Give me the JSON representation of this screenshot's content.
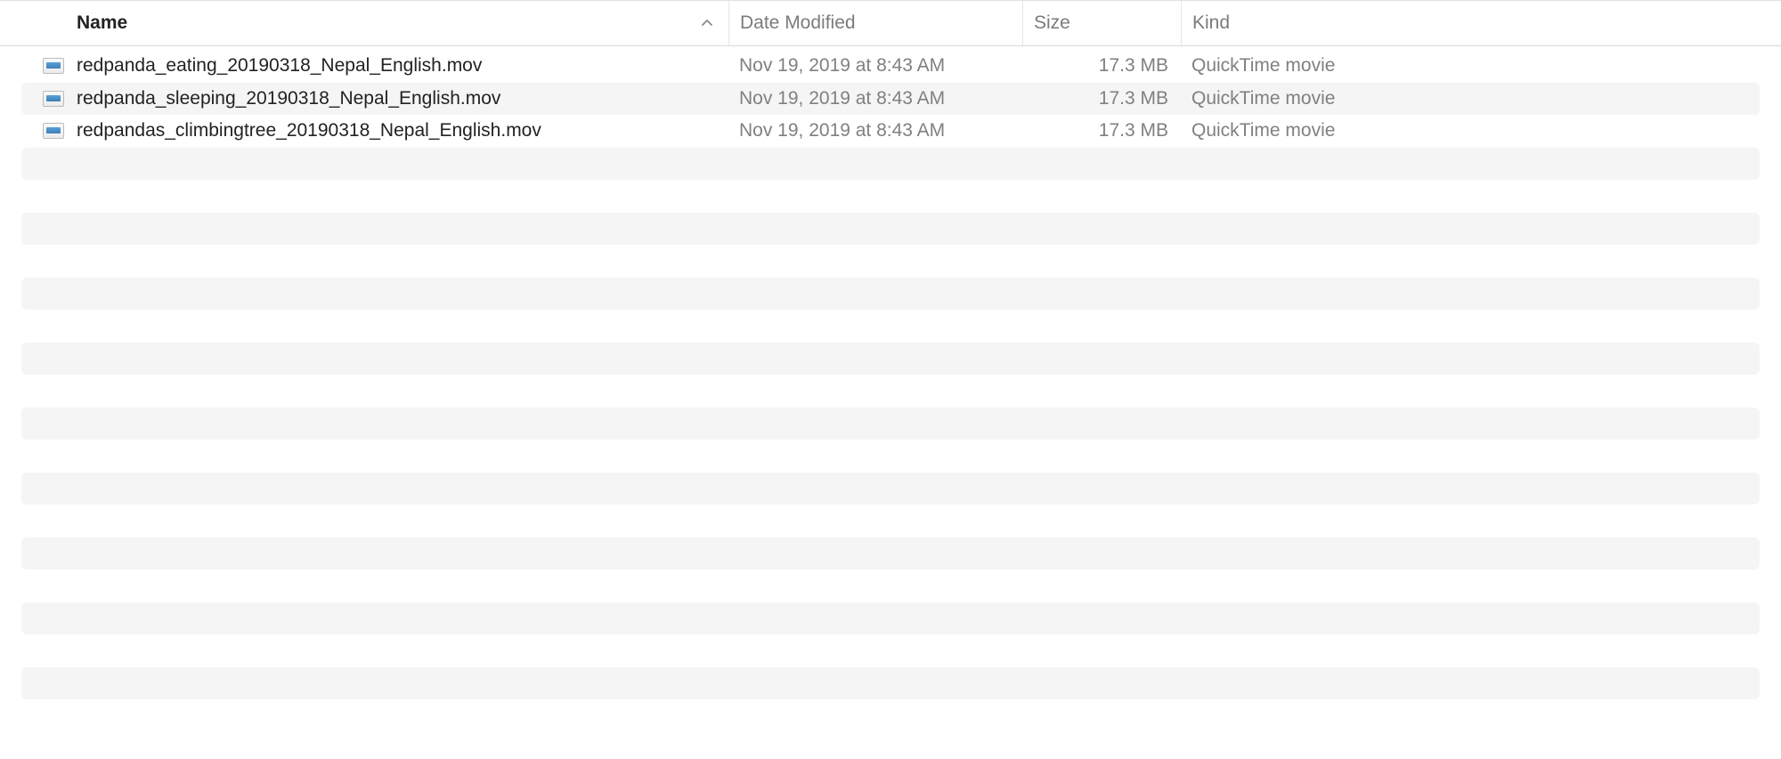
{
  "columns": {
    "name": "Name",
    "date": "Date Modified",
    "size": "Size",
    "kind": "Kind"
  },
  "sort": {
    "column": "name",
    "direction": "ascending"
  },
  "files": [
    {
      "name": "redpanda_eating_20190318_Nepal_English.mov",
      "date_modified": "Nov 19, 2019 at 8:43 AM",
      "size": "17.3 MB",
      "kind": "QuickTime movie"
    },
    {
      "name": "redpanda_sleeping_20190318_Nepal_English.mov",
      "date_modified": "Nov 19, 2019 at 8:43 AM",
      "size": "17.3 MB",
      "kind": "QuickTime movie"
    },
    {
      "name": "redpandas_climbingtree_20190318_Nepal_English.mov",
      "date_modified": "Nov 19, 2019 at 8:43 AM",
      "size": "17.3 MB",
      "kind": "QuickTime movie"
    }
  ],
  "empty_row_count": 18
}
